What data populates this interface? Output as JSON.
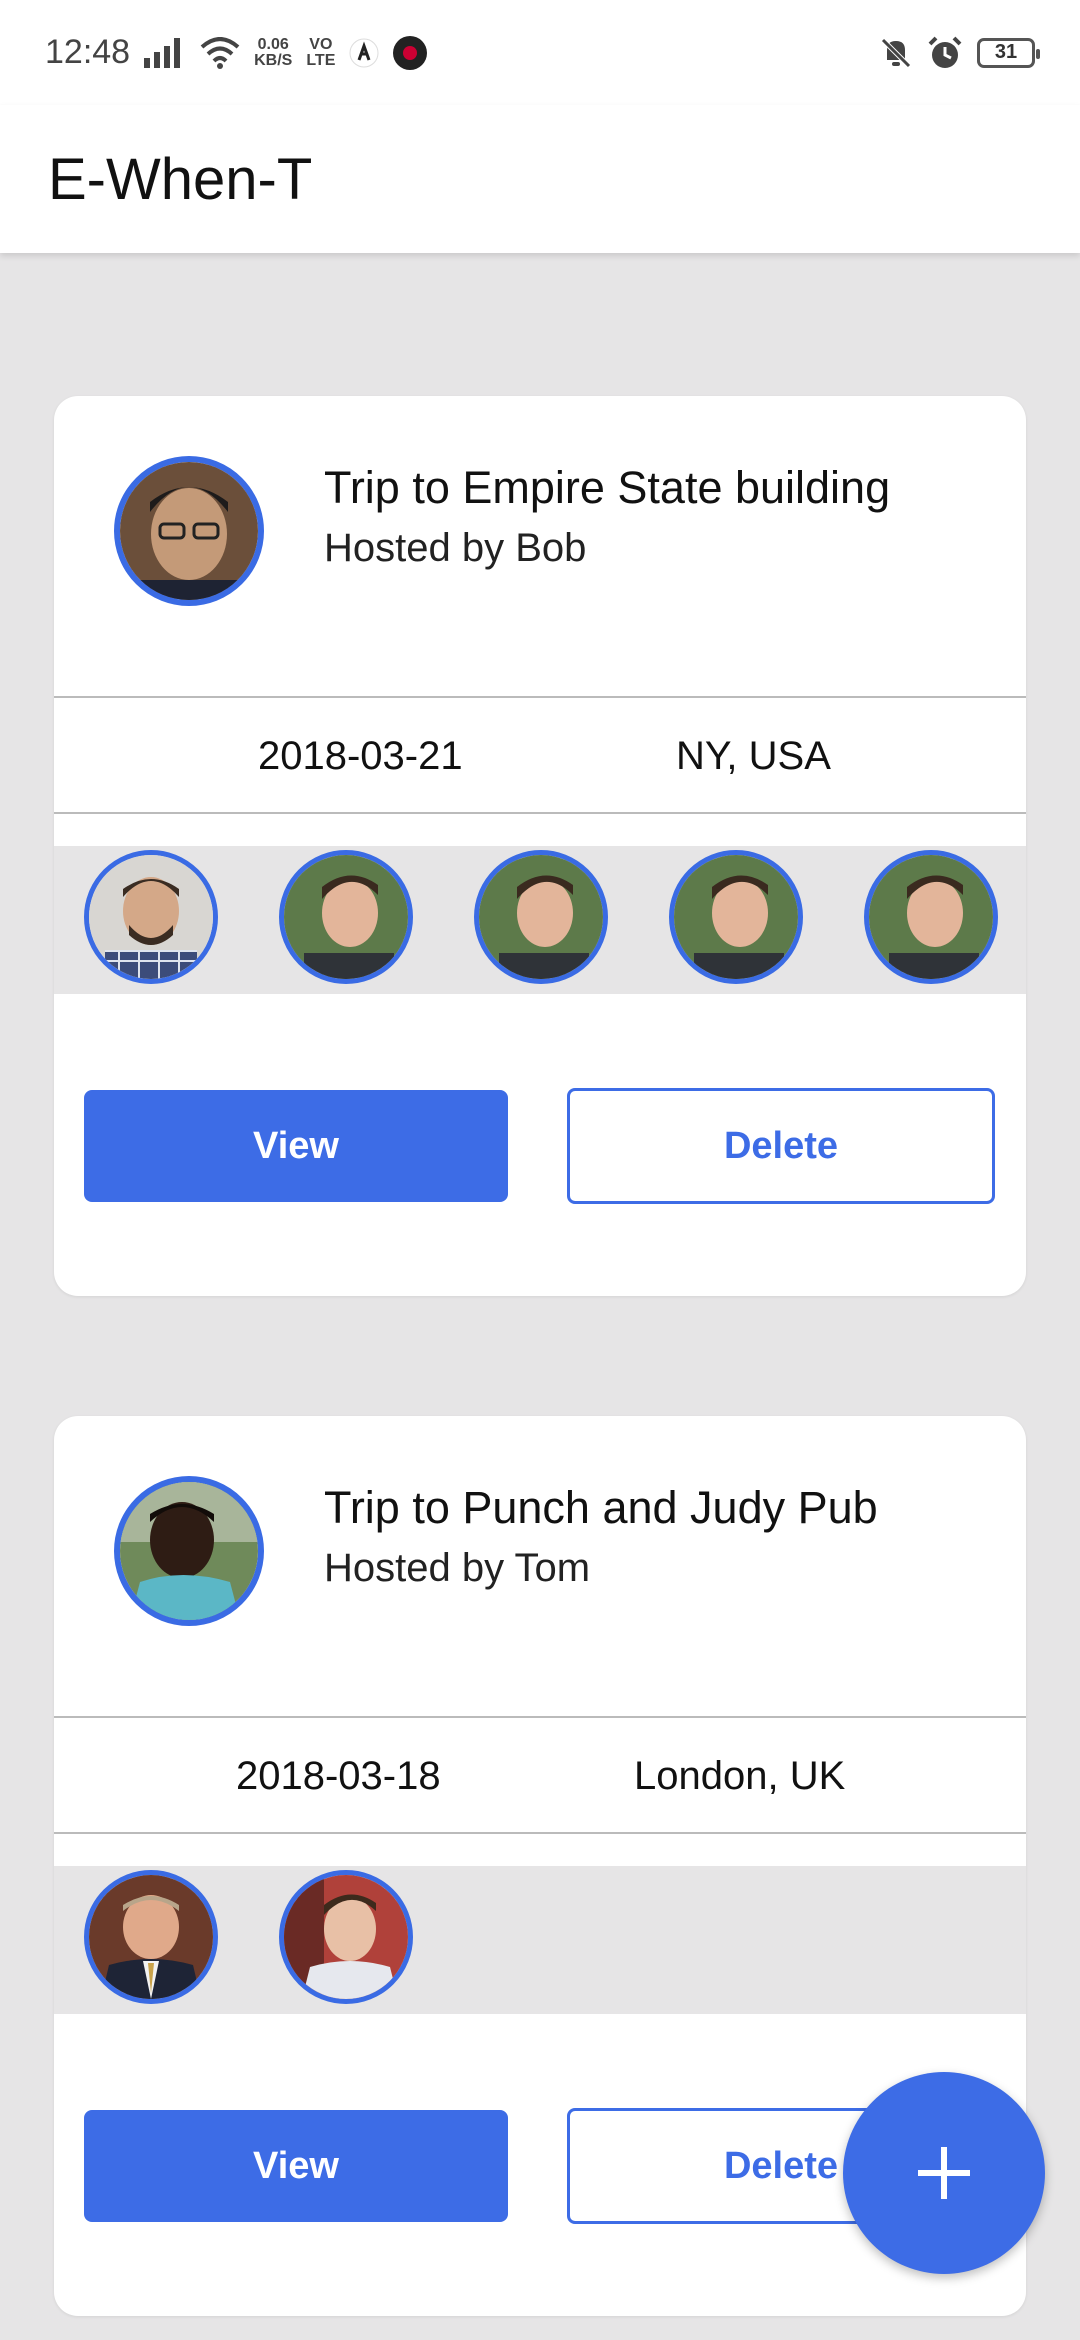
{
  "status_bar": {
    "time": "12:48",
    "net_speed_value": "0.06",
    "net_speed_unit": "KB/S",
    "volte_top": "VO",
    "volte_bottom": "LTE",
    "battery": "31"
  },
  "app_bar": {
    "title": "E-When-T"
  },
  "events": [
    {
      "title": "Trip to Empire State building",
      "host": "Hosted by Bob",
      "date": "2018-03-21",
      "location": "NY, USA",
      "view_label": "View",
      "delete_label": "Delete"
    },
    {
      "title": "Trip to Punch and Judy Pub",
      "host": "Hosted by Tom",
      "date": "2018-03-18",
      "location": "London, UK",
      "view_label": "View",
      "delete_label": "Delete"
    }
  ],
  "fab": {
    "icon": "plus-icon"
  },
  "colors": {
    "accent": "#3d6ce6",
    "background": "#e6e5e6"
  }
}
